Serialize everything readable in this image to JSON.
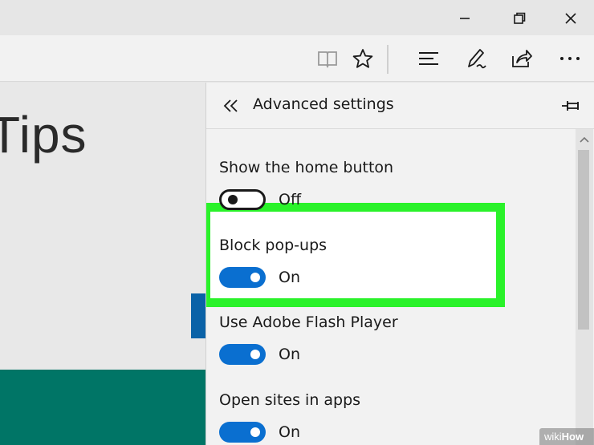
{
  "titlebar": {
    "controls": [
      "minimize-icon",
      "restore-icon",
      "close-icon"
    ]
  },
  "toolbar": {
    "icons": [
      "reading-view-icon",
      "favorite-star-icon",
      "hub-icon",
      "web-note-icon",
      "share-icon",
      "more-icon"
    ]
  },
  "webpage": {
    "title_fragment": "Tips",
    "colors": {
      "blue_block": "#0a62a7",
      "teal_band": "#007566"
    }
  },
  "panel": {
    "title": "Advanced settings",
    "settings": [
      {
        "label": "Show the home button",
        "state": "Off",
        "on": false
      },
      {
        "label": "Block pop-ups",
        "state": "On",
        "on": true
      },
      {
        "label": "Use Adobe Flash Player",
        "state": "On",
        "on": true
      },
      {
        "label": "Open sites in apps",
        "state": "On",
        "on": true
      }
    ],
    "highlight_color": "#2af22a",
    "toggle_on_color": "#0a6fd0"
  },
  "watermark": {
    "prefix": "wiki",
    "suffix": "How"
  }
}
